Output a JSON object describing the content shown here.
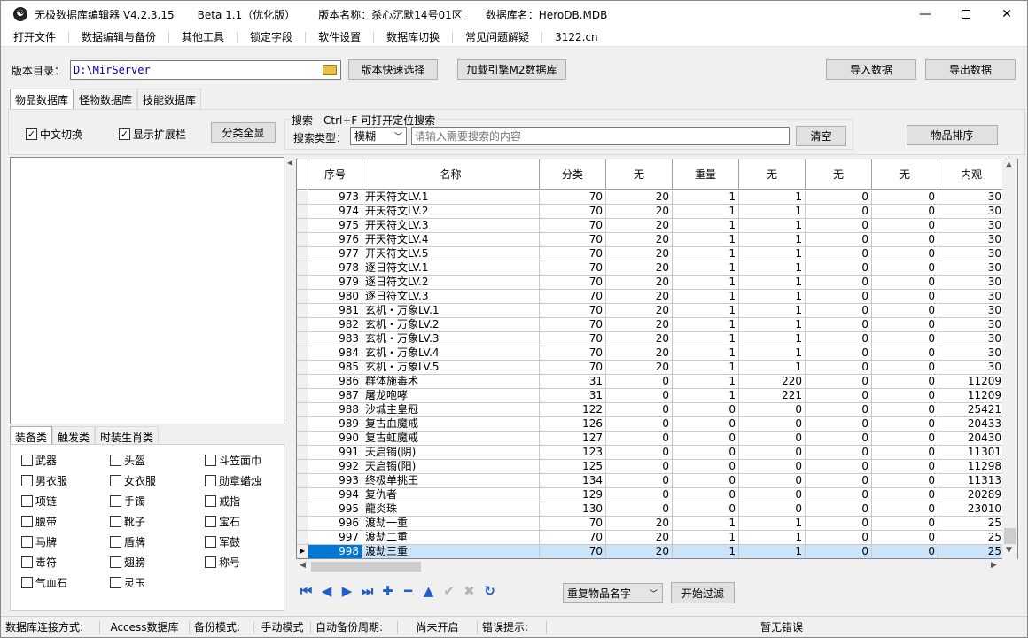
{
  "title": {
    "app": "无极数据库编辑器 V4.2.3.15",
    "beta": "Beta 1.1（优化版）",
    "version_name": "版本名称：杀心沉默14号01区",
    "db_name": "数据库名：HeroDB.MDB"
  },
  "menu": [
    "打开文件",
    "数据编辑与备份",
    "其他工具",
    "锁定字段",
    "软件设置",
    "数据库切换",
    "常见问题解疑",
    "3122.cn"
  ],
  "toolbar": {
    "version_dir_label": "版本目录：",
    "version_dir_value": "D:\\MirServer",
    "quick_select": "版本快速选择",
    "load_m2": "加载引擎M2数据库",
    "import": "导入数据",
    "export": "导出数据"
  },
  "db_tabs": [
    "物品数据库",
    "怪物数据库",
    "技能数据库"
  ],
  "options": {
    "chinese_switch": "中文切换",
    "show_ext": "显示扩展栏",
    "show_all_cat": "分类全显",
    "search_title": "搜索　Ctrl+F 可打开定位搜索",
    "search_type_label": "搜索类型：",
    "search_type_value": "模糊",
    "search_placeholder": "请输入需要搜索的内容",
    "clear": "清空",
    "sort": "物品排序"
  },
  "cat_tabs": [
    "装备类",
    "触发类",
    "时装生肖类"
  ],
  "categories": [
    "武器",
    "头盔",
    "斗笠面巾",
    "男衣服",
    "女衣服",
    "勋章蜡烛",
    "项链",
    "手镯",
    "戒指",
    "腰带",
    "靴子",
    "宝石",
    "马牌",
    "盾牌",
    "军鼓",
    "毒符",
    "翅膀",
    "称号",
    "气血石",
    "灵玉"
  ],
  "grid": {
    "columns": [
      "序号",
      "名称",
      "分类",
      "无",
      "重量",
      "无",
      "无",
      "无",
      "内观"
    ],
    "rows": [
      [
        "973",
        "开天符文LV.1",
        "70",
        "20",
        "1",
        "1",
        "0",
        "0",
        "30"
      ],
      [
        "974",
        "开天符文LV.2",
        "70",
        "20",
        "1",
        "1",
        "0",
        "0",
        "30"
      ],
      [
        "975",
        "开天符文LV.3",
        "70",
        "20",
        "1",
        "1",
        "0",
        "0",
        "30"
      ],
      [
        "976",
        "开天符文LV.4",
        "70",
        "20",
        "1",
        "1",
        "0",
        "0",
        "30"
      ],
      [
        "977",
        "开天符文LV.5",
        "70",
        "20",
        "1",
        "1",
        "0",
        "0",
        "30"
      ],
      [
        "978",
        "逐日符文LV.1",
        "70",
        "20",
        "1",
        "1",
        "0",
        "0",
        "30"
      ],
      [
        "979",
        "逐日符文LV.2",
        "70",
        "20",
        "1",
        "1",
        "0",
        "0",
        "30"
      ],
      [
        "980",
        "逐日符文LV.3",
        "70",
        "20",
        "1",
        "1",
        "0",
        "0",
        "30"
      ],
      [
        "981",
        "玄机・万象LV.1",
        "70",
        "20",
        "1",
        "1",
        "0",
        "0",
        "30"
      ],
      [
        "982",
        "玄机・万象LV.2",
        "70",
        "20",
        "1",
        "1",
        "0",
        "0",
        "30"
      ],
      [
        "983",
        "玄机・万象LV.3",
        "70",
        "20",
        "1",
        "1",
        "0",
        "0",
        "30"
      ],
      [
        "984",
        "玄机・万象LV.4",
        "70",
        "20",
        "1",
        "1",
        "0",
        "0",
        "30"
      ],
      [
        "985",
        "玄机・万象LV.5",
        "70",
        "20",
        "1",
        "1",
        "0",
        "0",
        "30"
      ],
      [
        "986",
        "群体施毒术",
        "31",
        "0",
        "1",
        "220",
        "0",
        "0",
        "11209"
      ],
      [
        "987",
        "屠龙咆哮",
        "31",
        "0",
        "1",
        "221",
        "0",
        "0",
        "11209"
      ],
      [
        "988",
        "沙城主皇冠",
        "122",
        "0",
        "0",
        "0",
        "0",
        "0",
        "25421"
      ],
      [
        "989",
        "复古血魔戒",
        "126",
        "0",
        "0",
        "0",
        "0",
        "0",
        "20433"
      ],
      [
        "990",
        "复古虹魔戒",
        "127",
        "0",
        "0",
        "0",
        "0",
        "0",
        "20430"
      ],
      [
        "991",
        "天启镯(阴)",
        "123",
        "0",
        "0",
        "0",
        "0",
        "0",
        "11301"
      ],
      [
        "992",
        "天启镯(阳)",
        "125",
        "0",
        "0",
        "0",
        "0",
        "0",
        "11298"
      ],
      [
        "993",
        "终极单挑王",
        "134",
        "0",
        "0",
        "0",
        "0",
        "0",
        "11313"
      ],
      [
        "994",
        "复仇者",
        "129",
        "0",
        "0",
        "0",
        "0",
        "0",
        "20289"
      ],
      [
        "995",
        "龍炎珠",
        "130",
        "0",
        "0",
        "0",
        "0",
        "0",
        "23010"
      ],
      [
        "996",
        "渡劫一重",
        "70",
        "20",
        "1",
        "1",
        "0",
        "0",
        "25"
      ],
      [
        "997",
        "渡劫二重",
        "70",
        "20",
        "1",
        "1",
        "0",
        "0",
        "25"
      ],
      [
        "998",
        "渡劫三重",
        "70",
        "20",
        "1",
        "1",
        "0",
        "0",
        "25"
      ]
    ],
    "selected_row": "998"
  },
  "bottom": {
    "dup_select": "重复物品名字",
    "start_filter": "开始过滤"
  },
  "status": {
    "conn_label": "数据库连接方式:",
    "conn_value": "Access数据库",
    "backup_label": "备份模式:",
    "backup_value": "手动模式",
    "auto_label": "自动备份周期:",
    "auto_value": "尚未开启",
    "err_label": "错误提示:",
    "err_value": "暂无错误"
  }
}
